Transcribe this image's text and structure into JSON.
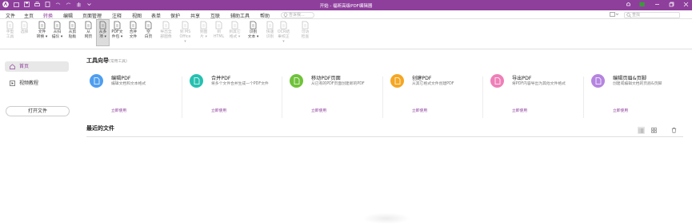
{
  "titlebar": {
    "title": "开始 - 福昕高级PDF编辑器"
  },
  "menu": {
    "items": [
      "文件",
      "主页",
      "转换",
      "编辑",
      "页面管理",
      "注释",
      "视图",
      "表单",
      "保护",
      "共享",
      "互联",
      "辅助工具",
      "帮助"
    ],
    "active_index": 2,
    "search_placeholder": "告诉我...",
    "find_placeholder": "查找"
  },
  "ribbon": {
    "buttons": [
      {
        "line1": "手型",
        "line2": "工具",
        "disabled": true
      },
      {
        "line1": "选择",
        "line2": "",
        "disabled": true
      },
      {
        "line1": "文件",
        "line2": "转换 ▾",
        "disabled": false
      },
      {
        "line1": "从扫",
        "line2": "描仪 ▾",
        "disabled": false
      },
      {
        "line1": "从剪",
        "line2": "贴板",
        "disabled": false
      },
      {
        "line1": "从",
        "line2": "网页",
        "disabled": false
      },
      {
        "line1": "从多",
        "line2": "项 ▾",
        "disabled": false,
        "selected": true
      },
      {
        "line1": "PDF文",
        "line2": "件包 ▾",
        "disabled": false
      },
      {
        "line1": "合并",
        "line2": "文件",
        "disabled": false
      },
      {
        "line1": "空",
        "line2": "白页",
        "disabled": false
      },
      {
        "line1": "导出全",
        "line2": "部图像",
        "disabled": true
      },
      {
        "line1": "到 MS",
        "line2": "Office ▾",
        "disabled": true
      },
      {
        "line1": "到图",
        "line2": "片 ▾",
        "disabled": true
      },
      {
        "line1": "到",
        "line2": "HTML",
        "disabled": true
      },
      {
        "line1": "到其它",
        "line2": "格式 ▾",
        "disabled": true
      },
      {
        "line1": "识别",
        "line2": "文本 ▾",
        "disabled": false
      },
      {
        "line1": "快速",
        "line2": "识别",
        "disabled": true
      },
      {
        "line1": "OCR结",
        "line2": "果校正 ▾",
        "disabled": true
      },
      {
        "line1": "可访",
        "line2": "检查",
        "disabled": true
      }
    ]
  },
  "sidebar": {
    "items": [
      {
        "label": "首页",
        "icon": "home-icon",
        "active": true
      },
      {
        "label": "视频教程",
        "icon": "video-icon",
        "active": false
      }
    ],
    "open_file_label": "打开文件"
  },
  "main": {
    "tools_title": "工具向导",
    "tools_subtitle": "(常用工具)",
    "cards": [
      {
        "title": "编辑PDF",
        "desc": "编辑文档和文本格式",
        "use": "立即使用",
        "color": "#4e9ef0",
        "icon": "edit-pdf-icon"
      },
      {
        "title": "合并PDF",
        "desc": "将多个文件合并生成一个PDF文件",
        "use": "立即使用",
        "color": "#26c0b0",
        "icon": "merge-pdf-icon"
      },
      {
        "title": "移动PDF页面",
        "desc": "从已有的PDF页面创建新的PDF",
        "use": "立即使用",
        "color": "#6fc23a",
        "icon": "move-pages-icon"
      },
      {
        "title": "创建PDF",
        "desc": "从其它格式文件创建PDF",
        "use": "立即使用",
        "color": "#f5a623",
        "icon": "create-pdf-icon"
      },
      {
        "title": "导出PDF",
        "desc": "将PDF内容导出为其他文件格式",
        "use": "立即使用",
        "color": "#ef7fb8",
        "icon": "export-pdf-icon"
      },
      {
        "title": "编辑页眉&页脚",
        "desc": "创建或编辑文档的页眉&页脚",
        "use": "立即使用",
        "color": "#b584e0",
        "icon": "header-footer-icon"
      }
    ],
    "recent_title": "最近的文件"
  }
}
